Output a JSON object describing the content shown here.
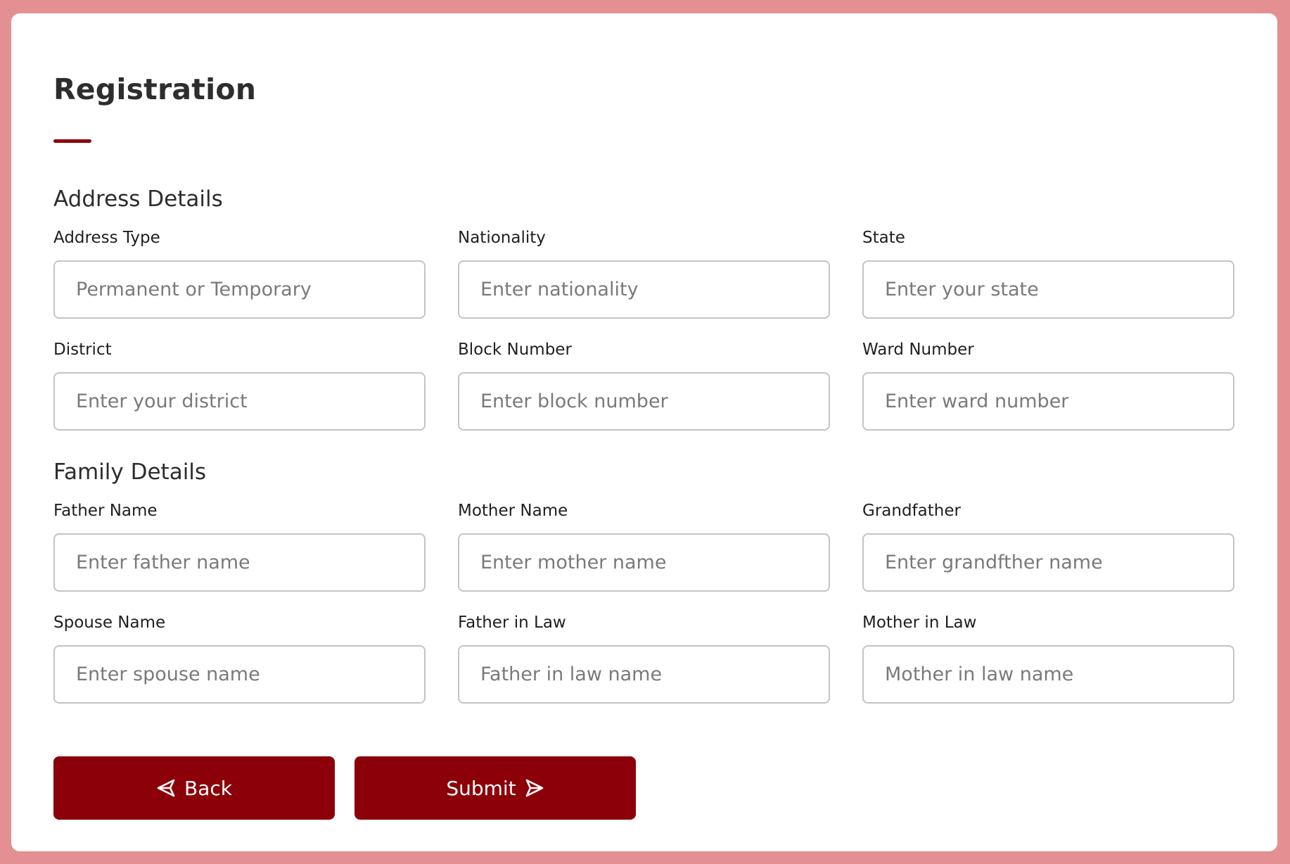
{
  "page": {
    "title": "Registration"
  },
  "address_section": {
    "title": "Address Details",
    "fields": [
      {
        "label": "Address Type",
        "placeholder": "Permanent or Temporary",
        "value": ""
      },
      {
        "label": "Nationality",
        "placeholder": "Enter nationality",
        "value": ""
      },
      {
        "label": "State",
        "placeholder": "Enter your state",
        "value": ""
      },
      {
        "label": "District",
        "placeholder": "Enter your district",
        "value": ""
      },
      {
        "label": "Block Number",
        "placeholder": "Enter block number",
        "value": ""
      },
      {
        "label": "Ward Number",
        "placeholder": "Enter ward number",
        "value": ""
      }
    ]
  },
  "family_section": {
    "title": "Family Details",
    "fields": [
      {
        "label": "Father Name",
        "placeholder": "Enter father name",
        "value": ""
      },
      {
        "label": "Mother Name",
        "placeholder": "Enter mother name",
        "value": ""
      },
      {
        "label": "Grandfather",
        "placeholder": "Enter grandfther name",
        "value": ""
      },
      {
        "label": "Spouse Name",
        "placeholder": "Enter spouse name",
        "value": ""
      },
      {
        "label": "Father in Law",
        "placeholder": "Father in law name",
        "value": ""
      },
      {
        "label": "Mother in Law",
        "placeholder": "Mother in law name",
        "value": ""
      }
    ]
  },
  "actions": {
    "back_label": "Back",
    "back_icon": "send-left-icon",
    "submit_label": "Submit",
    "submit_icon": "send-right-icon"
  },
  "colors": {
    "accent": "#8c0009",
    "page_background": "#e48f92",
    "card_background": "#ffffff",
    "input_border": "#c4c4c4"
  }
}
